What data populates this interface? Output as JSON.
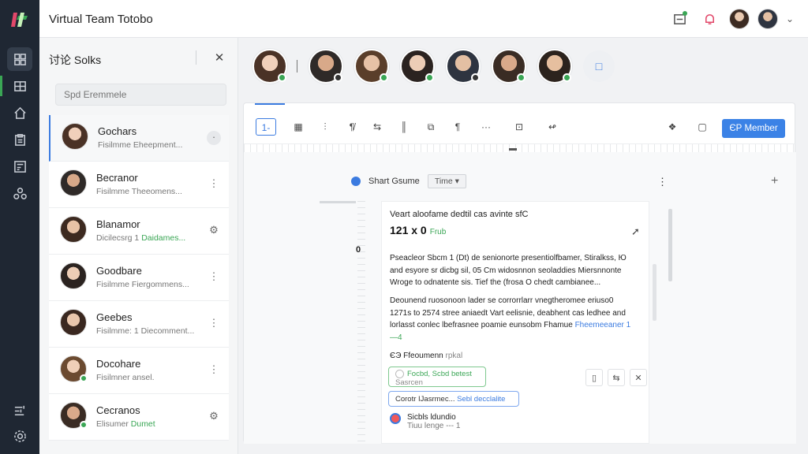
{
  "app": {
    "title": "Virtual Team Totobo"
  },
  "colors": {
    "accent": "#3b82e6",
    "online": "#3aa655",
    "rail": "#1f2733"
  },
  "rail": {
    "items": [
      "dashboard-icon",
      "grid-icon",
      "home-icon",
      "clipboard-icon",
      "report-icon",
      "cluster-icon",
      "sliders-icon",
      "settings-icon"
    ]
  },
  "panel": {
    "title": "讨论 Solks",
    "search_placeholder": "Spd Eremmele",
    "contacts": [
      {
        "name": "Gochars",
        "sub": "Fisilmme Eheepment...",
        "sub_green": ""
      },
      {
        "name": "Becranor",
        "sub": "Fisilmme Theeomens...",
        "sub_green": ""
      },
      {
        "name": "Blanamor",
        "sub": "Dicilecsrg 1",
        "sub_green": "Daidames..."
      },
      {
        "name": "Goodbare",
        "sub": "Fisilmme Fiergommens...",
        "sub_green": ""
      },
      {
        "name": "Geebes",
        "sub": "Fisilmme: 1 Diecomment...",
        "sub_green": ""
      },
      {
        "name": "Docohare",
        "sub": "Fisilmner ansel.",
        "sub_green": ""
      },
      {
        "name": "Cecranos",
        "sub": "Elisumer",
        "sub_green": "Dumet"
      }
    ]
  },
  "toolbar": {
    "items": [
      "1-",
      "▦",
      "⫶",
      "¶̸",
      "⇆",
      "║",
      "⧉",
      "¶",
      "···",
      "⊡",
      "↫"
    ],
    "right_icons": [
      "❖",
      "▢"
    ],
    "add_button": "ЄР Member"
  },
  "sheet": {
    "name": "Shart Gsume",
    "select": "Time",
    "margin_num": "0"
  },
  "doc": {
    "heading": "Veart aloofame dedtil cas avinte sfC",
    "value": "121 x 0",
    "value_tag": "Frub",
    "para1": "Pseacleor Sbcm 1 (Dt) de senionorte presentiolfbamer, Stiralkss, Ю and esyore sr dicbg sil, 05 Cm widosnnon seoladdies Miersnnonte Wroge to odnatente sis. Tief the (frosa O chedt cambianee...",
    "para2": "Deounend ruosonoon lader se corrorrlarr vnegtheromee eriuso0 1271s to 2574 stree aniaedt Vart eelisnie, deabhent cas ledhee and lorlasst conlec lbefrasnee poamie eunsobm Fhamue",
    "para2_link": "Fheemeeaner 1",
    "para2_tag": "—4",
    "subhead": "ЄЭ Ffeoumenn",
    "subhead_light": "rpkal",
    "chip1_line1": "Focbd, Scbd betest",
    "chip1_line2": "Sasrcen",
    "chip2_a": "Corotr IJasrmec...",
    "chip2_b": "Sebl decclalite",
    "action_icons": [
      "▯",
      "⇆",
      "✕"
    ],
    "comment_name": "Sicbls ldundio",
    "comment_sub": "Tiuu lenge --- 1"
  }
}
